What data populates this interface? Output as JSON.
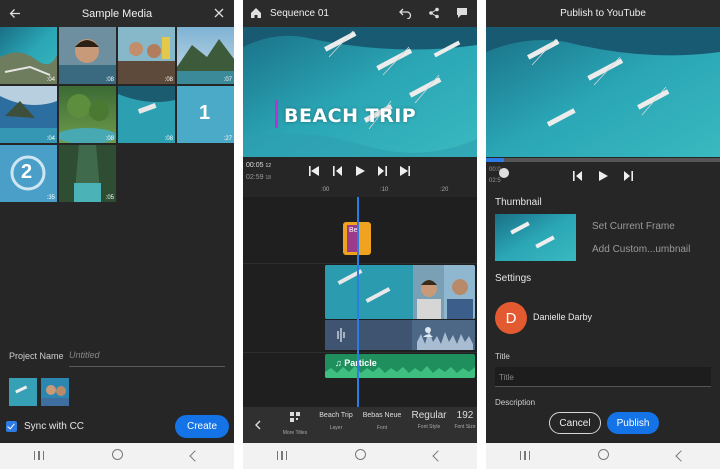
{
  "media_picker": {
    "title": "Sample Media",
    "durations": [
      ":04",
      ":08",
      ":08",
      ":07",
      ":04",
      ":08",
      ":08",
      ":27",
      ":35",
      ":05"
    ],
    "selection_numbers": [
      "1",
      "2"
    ],
    "project_name_label": "Project Name",
    "project_name_placeholder": "Untitled",
    "sync_label": "Sync with CC",
    "create_label": "Create"
  },
  "editor": {
    "title": "Sequence 01",
    "overlay_title": "BEACH TRIP",
    "time_current": "00:05",
    "time_current_frames": "12",
    "time_total": "02:59",
    "time_total_frames": "18",
    "ruler_marks": [
      ":00",
      ":10",
      ":20"
    ],
    "title_clip_label": "Be",
    "music_clip_label": "Particle",
    "bottom_items": [
      {
        "value": "",
        "key": "More Titles"
      },
      {
        "value": "Beach Trip",
        "key": "Layer"
      },
      {
        "value": "Bebas Neue",
        "key": "Font"
      },
      {
        "value": "Regular",
        "key": "Font Style"
      },
      {
        "value": "192",
        "key": "Font Size"
      }
    ]
  },
  "publish": {
    "title": "Publish to YouTube",
    "time_current": "00:0",
    "time_total": "02:5",
    "thumbnail_heading": "Thumbnail",
    "set_current_frame": "Set Current Frame",
    "add_custom_thumbnail": "Add Custom...umbnail",
    "settings_heading": "Settings",
    "avatar_letter": "D",
    "account_name": "Danielle Darby",
    "title_label": "Title",
    "title_placeholder": "Title",
    "description_label": "Description",
    "cancel_label": "Cancel",
    "publish_label": "Publish"
  },
  "colors": {
    "accent_blue": "#1473e6",
    "title_clip": "#f0a31f",
    "music_clip": "#1f8f5e",
    "avatar": "#e35a30"
  }
}
